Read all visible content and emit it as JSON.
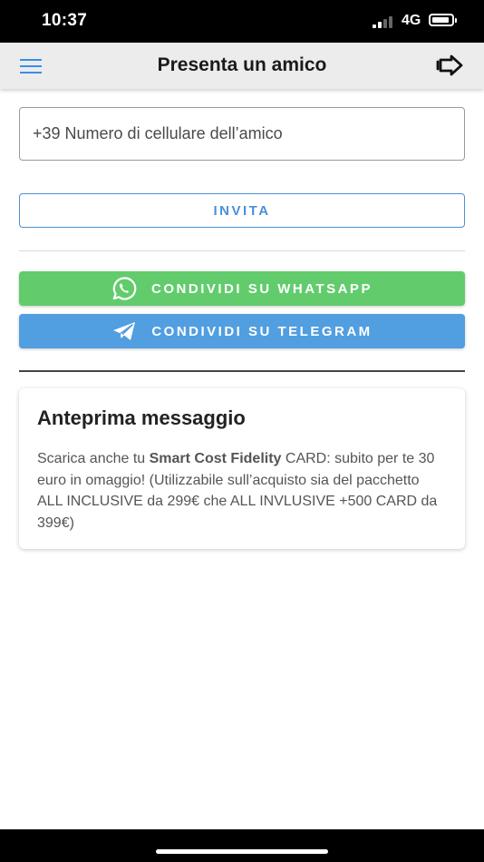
{
  "status_bar": {
    "time": "10:37",
    "network": "4G",
    "battery_level": 0.9,
    "signal_bars_active": 2
  },
  "header": {
    "title": "Presenta un amico",
    "menu_icon": "hamburger-menu-icon",
    "logout_icon": "logout-arrow-icon"
  },
  "form": {
    "phone_placeholder": "+39 Numero di cellulare dell’amico",
    "phone_value": "",
    "invite_label": "INVITA"
  },
  "share": {
    "whatsapp_label": "CONDIVIDI SU WHATSAPP",
    "telegram_label": "CONDIVIDI SU TELEGRAM"
  },
  "preview": {
    "title": "Anteprima messaggio",
    "text_before": "Scarica anche tu ",
    "brand": "Smart Cost Fidelity",
    "text_after": " CARD: subito per te 30 euro in omaggio! (Utilizzabile sull’acquisto sia del pacchetto ALL INCLUSIVE da 299€ che ALL INVLUSIVE +500 CARD da 399€)"
  },
  "colors": {
    "accent": "#4a90d9",
    "whatsapp": "#62cc6d",
    "telegram": "#519ee0",
    "header_bg": "#ececec"
  }
}
